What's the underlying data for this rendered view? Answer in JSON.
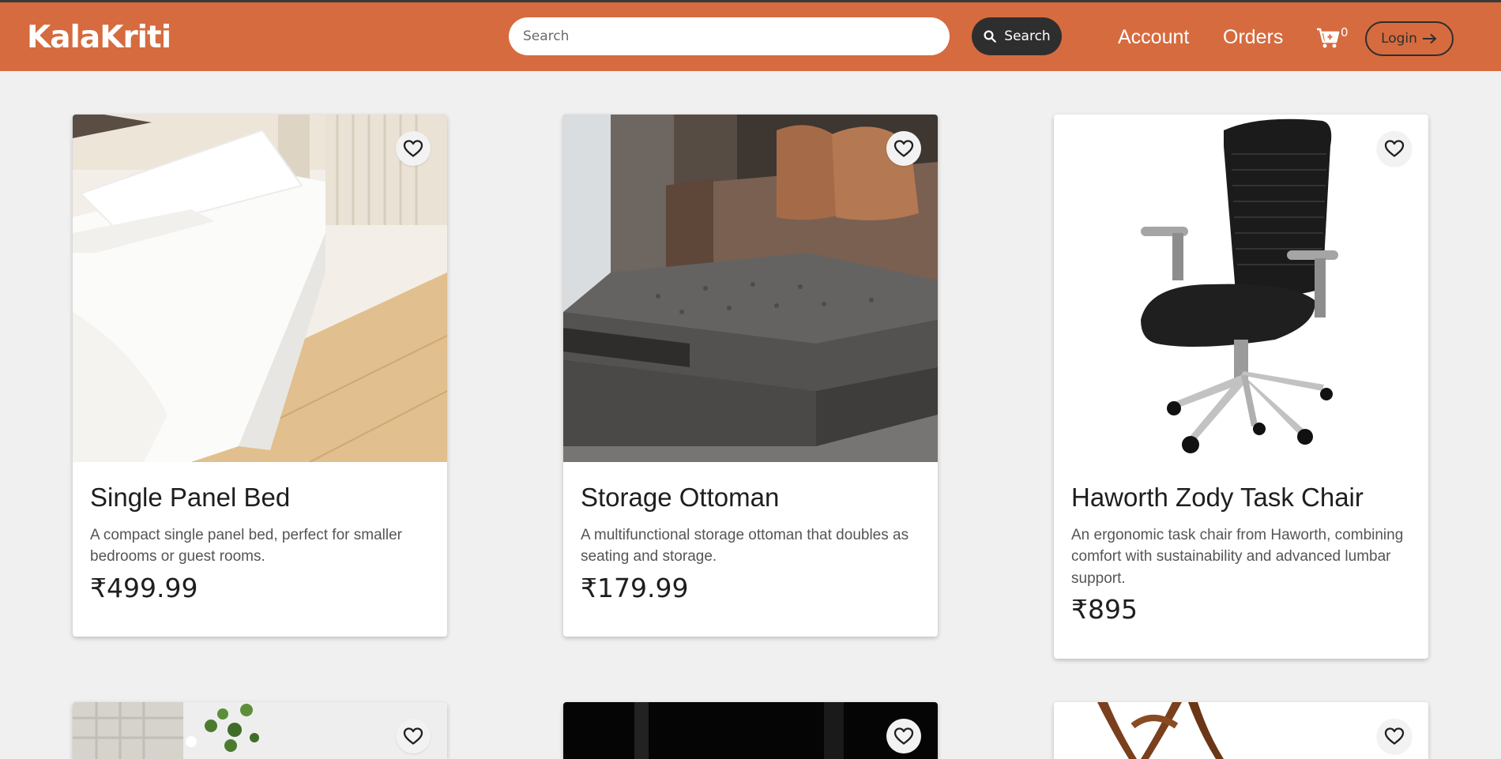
{
  "header": {
    "brand": "KalaKriti",
    "search_placeholder": "Search",
    "search_button": "Search",
    "nav_account": "Account",
    "nav_orders": "Orders",
    "cart_count": "0",
    "login_label": "Login"
  },
  "products": [
    {
      "name": "Single Panel Bed",
      "description": "A compact single panel bed, perfect for smaller bedrooms or guest rooms.",
      "price": "₹499.99"
    },
    {
      "name": "Storage Ottoman",
      "description": "A multifunctional storage ottoman that doubles as seating and storage.",
      "price": "₹179.99"
    },
    {
      "name": "Haworth Zody Task Chair",
      "description": "An ergonomic task chair from Haworth, combining comfort with sustainability and advanced lumbar support.",
      "price": "₹895"
    }
  ],
  "colors": {
    "header_bg": "#d66b3f",
    "page_bg": "#f0f0f0",
    "button_dark": "#2e2e2e"
  },
  "icons": {
    "search": "search-icon",
    "cart": "cart-icon",
    "login": "arrow-right-icon",
    "favorite": "heart-icon"
  }
}
